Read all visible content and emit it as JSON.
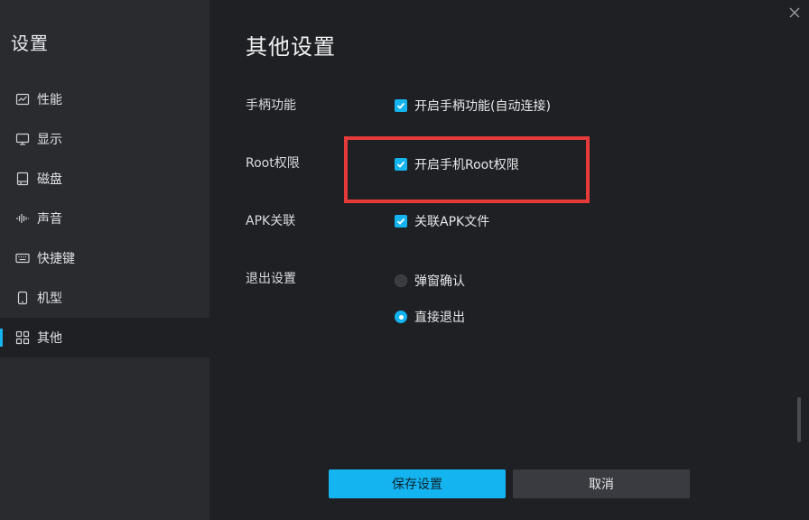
{
  "sidebar": {
    "title": "设置",
    "items": [
      {
        "label": "性能",
        "icon": "chart-line-icon"
      },
      {
        "label": "显示",
        "icon": "monitor-icon"
      },
      {
        "label": "磁盘",
        "icon": "disk-icon"
      },
      {
        "label": "声音",
        "icon": "audio-wave-icon"
      },
      {
        "label": "快捷键",
        "icon": "keyboard-icon"
      },
      {
        "label": "机型",
        "icon": "phone-icon"
      },
      {
        "label": "其他",
        "icon": "grid-icon",
        "active": true
      }
    ]
  },
  "main": {
    "title": "其他设置",
    "sections": {
      "gamepad": {
        "label": "手柄功能",
        "option": "开启手柄功能(自动连接)",
        "checked": true
      },
      "root": {
        "label": "Root权限",
        "option": "开启手机Root权限",
        "checked": true
      },
      "apk": {
        "label": "APK关联",
        "option": "关联APK文件",
        "checked": true
      },
      "exit": {
        "label": "退出设置",
        "options": [
          {
            "label": "弹窗确认",
            "selected": false
          },
          {
            "label": "直接退出",
            "selected": true
          }
        ]
      }
    }
  },
  "footer": {
    "save_label": "保存设置",
    "cancel_label": "取消"
  },
  "colors": {
    "accent": "#14b4f0",
    "highlight": "#e53a3a",
    "sidebar_bg": "#2a2b2f",
    "main_bg": "#1f2023"
  }
}
